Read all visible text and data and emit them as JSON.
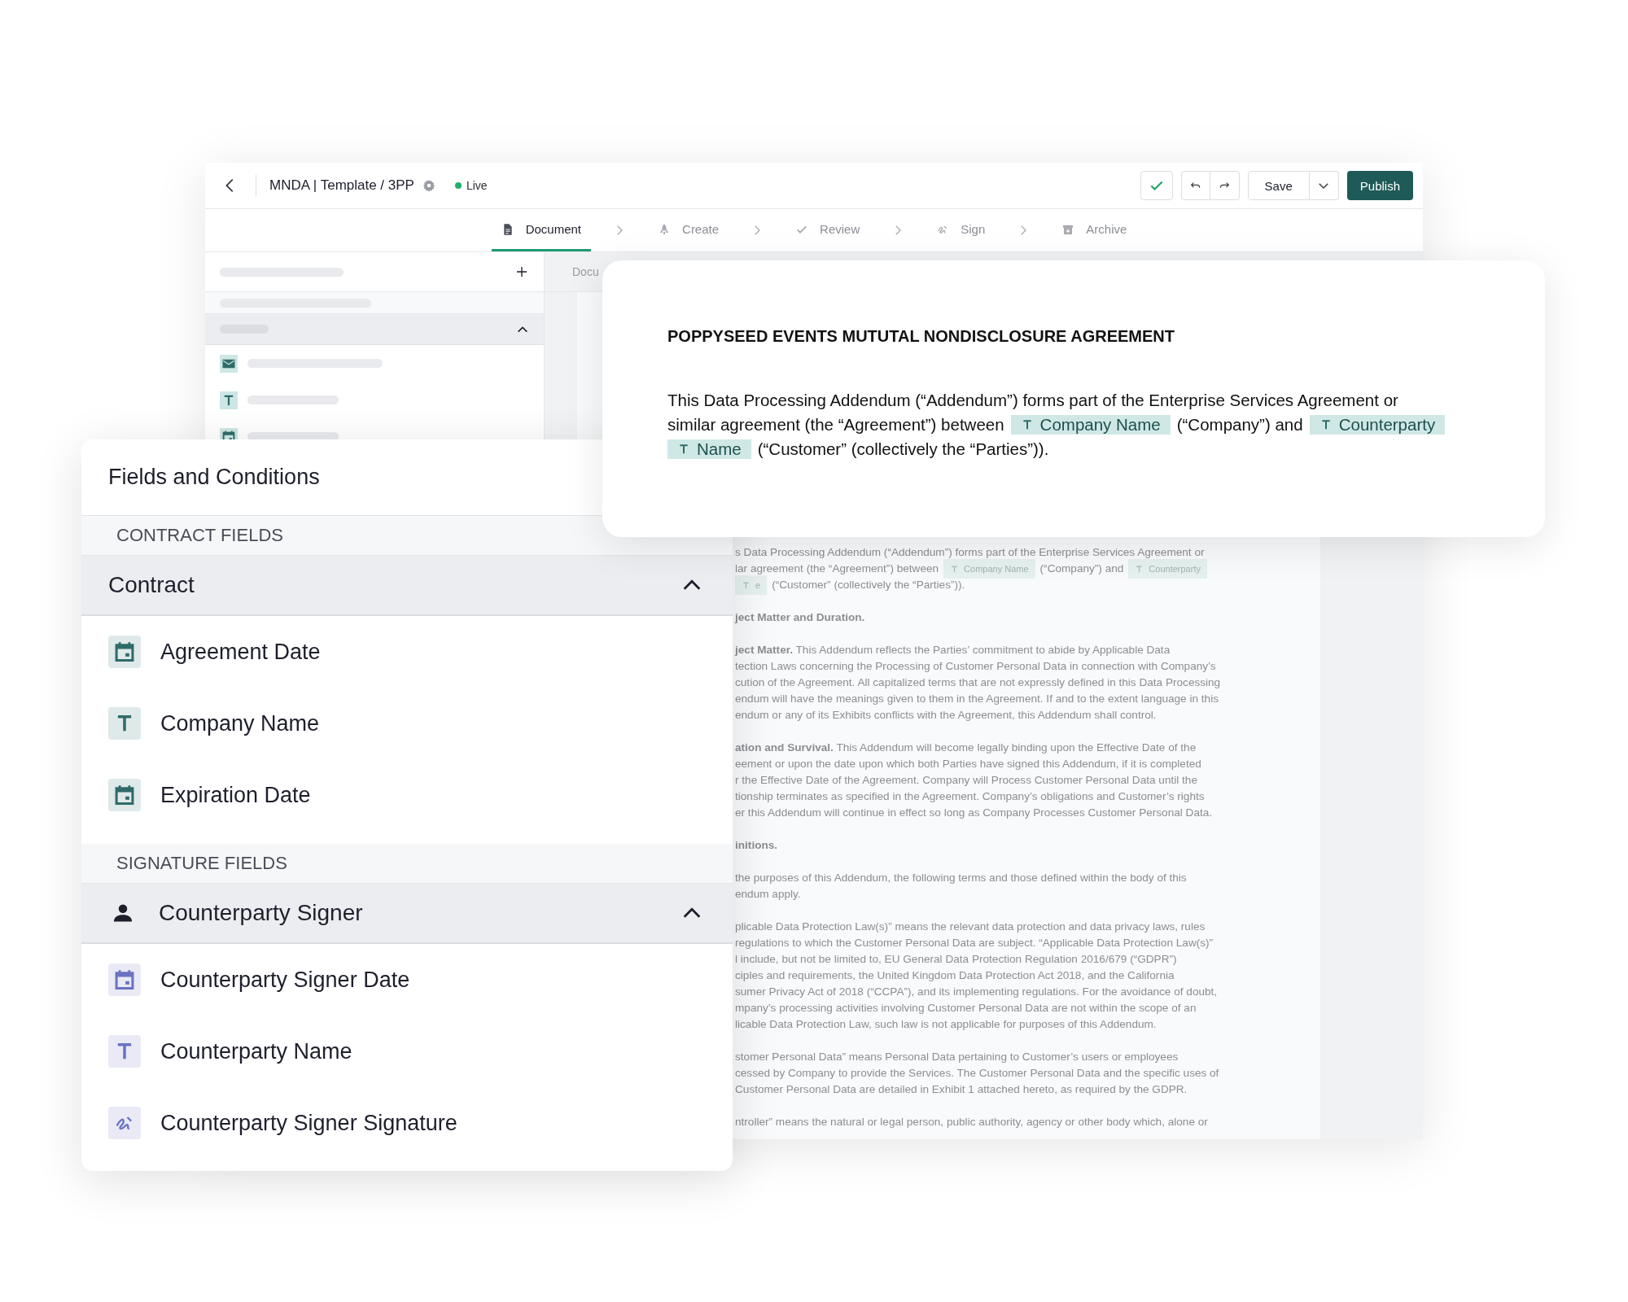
{
  "editor_window": {
    "title": "MNDA | Template / 3PP",
    "status": "Live",
    "save_label": "Save",
    "publish_label": "Publish",
    "steps": [
      {
        "label": "Document",
        "kind": "document",
        "selected": true
      },
      {
        "label": "Create",
        "kind": "rocket",
        "selected": false
      },
      {
        "label": "Review",
        "kind": "check",
        "selected": false
      },
      {
        "label": "Sign",
        "kind": "signature",
        "selected": false
      },
      {
        "label": "Archive",
        "kind": "archive",
        "selected": false
      }
    ],
    "breadcrumb": "Docu",
    "document": {
      "paragraphs": [
        {
          "lines": [
            [
              {
                "kind": "text",
                "text": "s Data Processing Addendum (“Addendum”) forms part of the Enterprise Services Agreement or"
              }
            ],
            [
              {
                "kind": "text",
                "text": "lar agreement (the “Agreement”) between"
              },
              {
                "kind": "field",
                "text": "Company Name"
              },
              {
                "kind": "text",
                "text": "(“Company”) and"
              },
              {
                "kind": "field",
                "text": "Counterparty"
              }
            ],
            [
              {
                "kind": "field",
                "text": "e"
              },
              {
                "kind": "text",
                "text": "(“Customer” (collectively the “Parties”))."
              }
            ]
          ]
        },
        {
          "lines": [
            [
              {
                "kind": "heading",
                "text": "ject Matter and Duration."
              }
            ]
          ]
        },
        {
          "lines": [
            [
              {
                "kind": "text",
                "text": "**ject Matter.** This Addendum reflects the Parties’ commitment to abide by Applicable Data"
              }
            ],
            [
              {
                "kind": "text",
                "text": "tection Laws concerning the Processing of Customer Personal Data in connection with Company’s"
              }
            ],
            [
              {
                "kind": "text",
                "text": "cution of the Agreement. All capitalized terms that are not expressly defined in this Data Processing"
              }
            ],
            [
              {
                "kind": "text",
                "text": "endum will have the meanings given to them in the Agreement. If and to the extent language in this"
              }
            ],
            [
              {
                "kind": "text",
                "text": "endum or any of its Exhibits conflicts with the Agreement, this Addendum shall control."
              }
            ]
          ]
        },
        {
          "lines": [
            [
              {
                "kind": "text",
                "text": "**ation and Survival.** This Addendum will become legally binding upon the Effective Date of the"
              }
            ],
            [
              {
                "kind": "text",
                "text": "eement or upon the date upon which both Parties have signed this Addendum, if it is completed"
              }
            ],
            [
              {
                "kind": "text",
                "text": "r the Effective Date of the Agreement. Company will Process Customer Personal Data until the"
              }
            ],
            [
              {
                "kind": "text",
                "text": "tionship terminates as specified in the Agreement. Company’s obligations and Customer’s rights"
              }
            ],
            [
              {
                "kind": "text",
                "text": "er this Addendum will continue in effect so long as Company Processes Customer Personal Data."
              }
            ]
          ]
        },
        {
          "lines": [
            [
              {
                "kind": "heading",
                "text": "initions."
              }
            ]
          ]
        },
        {
          "lines": [
            [
              {
                "kind": "text",
                "text": "the purposes of this Addendum, the following terms and those defined within the body of this"
              }
            ],
            [
              {
                "kind": "text",
                "text": "endum apply."
              }
            ]
          ]
        },
        {
          "lines": [
            [
              {
                "kind": "text",
                "text": "plicable Data Protection Law(s)” means the relevant data protection and data privacy laws, rules"
              }
            ],
            [
              {
                "kind": "text",
                "text": "regulations to which the Customer Personal Data are subject. “Applicable Data Protection Law(s)”"
              }
            ],
            [
              {
                "kind": "text",
                "text": "l include, but not be limited to, EU General Data Protection Regulation 2016/679 (“GDPR”)"
              }
            ],
            [
              {
                "kind": "text",
                "text": "ciples and requirements, the United Kingdom Data Protection Act 2018, and the California"
              }
            ],
            [
              {
                "kind": "text",
                "text": "sumer Privacy Act of 2018 (“CCPA”), and its implementing regulations.  For the avoidance of doubt,"
              }
            ],
            [
              {
                "kind": "text",
                "text": "mpany’s processing activities involving Customer Personal Data are not within the scope of an"
              }
            ],
            [
              {
                "kind": "text",
                "text": "licable Data Protection Law, such law is not applicable for purposes of this Addendum."
              }
            ]
          ]
        },
        {
          "lines": [
            [
              {
                "kind": "text",
                "text": "stomer Personal Data” means Personal Data pertaining to Customer’s users or employees"
              }
            ],
            [
              {
                "kind": "text",
                "text": "cessed by Company to provide the Services. The Customer Personal Data and the specific uses of"
              }
            ],
            [
              {
                "kind": "text",
                "text": "Customer Personal Data are detailed in Exhibit 1 attached hereto, as required by the GDPR."
              }
            ]
          ]
        },
        {
          "lines": [
            [
              {
                "kind": "text",
                "text": "ntroller” means the natural or legal person, public authority, agency or other body which, alone or"
              }
            ]
          ]
        }
      ]
    }
  },
  "document_card": {
    "title": "POPPYSEED EVENTS MUTUTAL NONDISCLOSURE AGREEMENT",
    "lines": [
      [
        {
          "kind": "text",
          "text": "This Data Processing Addendum (“Addendum”) forms part of the Enterprise Services Agreement or"
        }
      ],
      [
        {
          "kind": "text",
          "text": "similar agreement (the “Agreement”) between"
        },
        {
          "kind": "field",
          "text": "Company Name"
        },
        {
          "kind": "text",
          "text": "(“Company”) and"
        },
        {
          "kind": "field",
          "text": "Counterparty"
        }
      ],
      [
        {
          "kind": "field",
          "text": "Name"
        },
        {
          "kind": "text",
          "text": "(“Customer” (collectively the “Parties”))."
        }
      ]
    ]
  },
  "fields_panel": {
    "title": "Fields and Conditions",
    "sections": [
      {
        "heading": "CONTRACT FIELDS",
        "groups": [
          {
            "label": "Contract",
            "kind": "plain",
            "expanded": true,
            "color": "#2e6b69",
            "items": [
              {
                "label": "Agreement Date",
                "kind": "date"
              },
              {
                "label": "Company Name",
                "kind": "text"
              },
              {
                "label": "Expiration Date",
                "kind": "date"
              }
            ]
          }
        ]
      },
      {
        "heading": "SIGNATURE FIELDS",
        "groups": [
          {
            "label": "Counterparty Signer",
            "kind": "person",
            "expanded": true,
            "color": "#6b72c4",
            "items": [
              {
                "label": "Counterparty Signer Date",
                "kind": "date"
              },
              {
                "label": "Counterparty Name",
                "kind": "text"
              },
              {
                "label": "Counterparty Signer Signature",
                "kind": "signature"
              }
            ]
          }
        ]
      }
    ]
  }
}
